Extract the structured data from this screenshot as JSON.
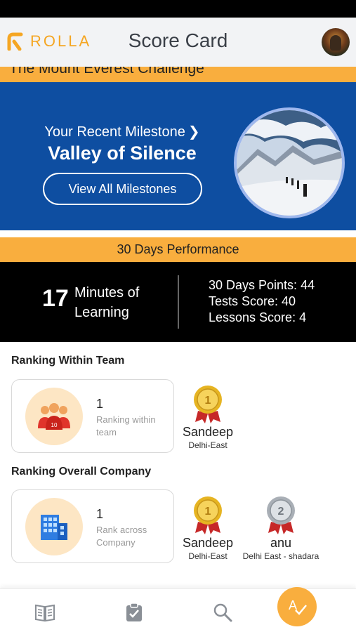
{
  "header": {
    "logo_text": "ROLLA",
    "title": "Score Card",
    "brand_color": "#f5a623"
  },
  "challenge": {
    "title": "The Mount Everest Challenge"
  },
  "milestone": {
    "label": "Your Recent Milestone",
    "label_icon": "chevron-right-icon",
    "name": "Valley of Silence",
    "button_label": "View All Milestones",
    "banner_color": "#0e4ea1"
  },
  "performance": {
    "header": "30 Days Performance",
    "minutes_value": "17",
    "minutes_label": "Minutes of Learning",
    "points": "30 Days Points: 44",
    "tests_score": "Tests Score: 40",
    "lessons_score": "Lessons Score: 4"
  },
  "team_ranking": {
    "title": "Ranking Within Team",
    "icon": "team-icon",
    "rank": "1",
    "rank_label": "Ranking within team",
    "winners": [
      {
        "medal": "gold-medal-icon",
        "name": "Sandeep",
        "area": "Delhi-East"
      }
    ]
  },
  "company_ranking": {
    "title": "Ranking Overall Company",
    "icon": "building-icon",
    "rank": "1",
    "rank_label": "Rank across Company",
    "winners": [
      {
        "medal": "gold-medal-icon",
        "name": "Sandeep",
        "area": "Delhi-East"
      },
      {
        "medal": "silver-medal-icon",
        "name": "anu",
        "area": "Delhi East - shadara"
      }
    ]
  },
  "bottom_nav": {
    "items": [
      "book-icon",
      "clipboard-check-icon",
      "search-icon",
      "score-icon"
    ],
    "active_color": "#f9ae3e"
  }
}
